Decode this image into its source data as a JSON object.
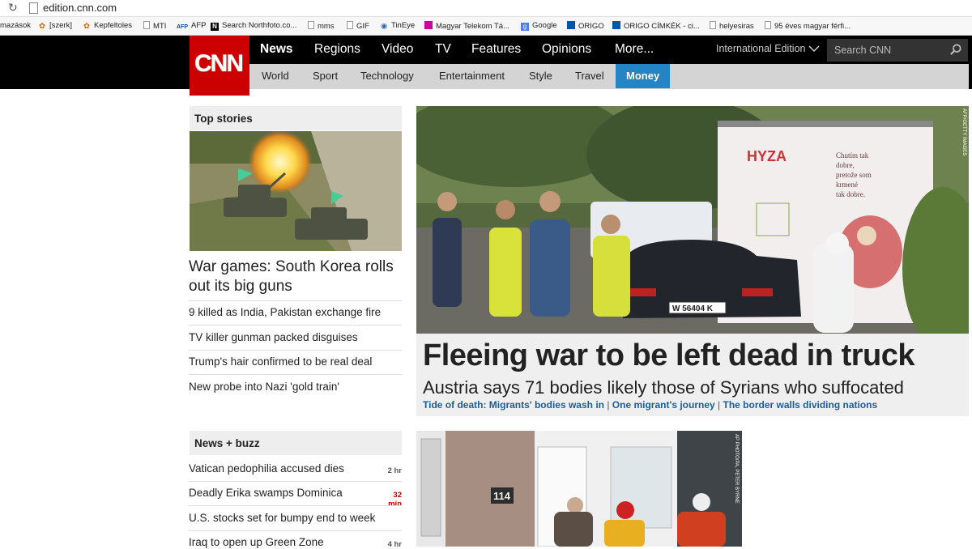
{
  "browser": {
    "url": "edition.cnn.com",
    "bookmarks": [
      "mazások",
      "[szerk]",
      "Kepfeltoles",
      "MTI",
      "AFP",
      "Search Northfoto.co...",
      "mms",
      "GIF",
      "TinEye",
      "Magyar Telekom Tá...",
      "Google",
      "ORIGO",
      "ORIGO CÍMKÉK - ci...",
      "helyesiras",
      "95 éves magyar férfi..."
    ]
  },
  "header": {
    "logo": "CNN",
    "nav": [
      "News",
      "Regions",
      "Video",
      "TV",
      "Features",
      "Opinions",
      "More..."
    ],
    "subnav": [
      "World",
      "Sport",
      "Technology",
      "Entertainment",
      "Style",
      "Travel",
      "Money"
    ],
    "edition": "International Edition",
    "search_placeholder": "Search CNN"
  },
  "top_stories": {
    "title": "Top stories",
    "lead": "War games: South Korea rolls out its big guns",
    "items": [
      "9 killed as India, Pakistan exchange fire",
      "TV killer gunman packed disguises",
      "Trump's hair confirmed to be real deal",
      "New probe into Nazi 'gold train'"
    ]
  },
  "hero": {
    "title": "Fleeing war to be left dead in truck",
    "subtitle": "Austria says 71 bodies likely those of Syrians who suffocated",
    "links": [
      "Tide of death: Migrants' bodies wash in",
      "One migrant's journey",
      "The border walls dividing nations"
    ],
    "credit": "AFP/GETTY IMAGES",
    "truck_brand": "HYZA",
    "truck_text": "Chutím tak dobre, pretože som krmené tak dobre.",
    "plate": "W 56404 K"
  },
  "news_buzz": {
    "title": "News + buzz",
    "items": [
      {
        "text": "Vatican pedophilia accused dies",
        "time": "2 hr"
      },
      {
        "text": "Deadly Erika swamps Dominica",
        "time": "32 min"
      },
      {
        "text": "U.S. stocks set for bumpy end to week",
        "time": ""
      },
      {
        "text": "Iraq to open up Green Zone",
        "time": "4 hr"
      }
    ]
  },
  "photo2": {
    "credit": "AP PHOTO/PA, PETER BYRNE",
    "house_number": "114"
  }
}
